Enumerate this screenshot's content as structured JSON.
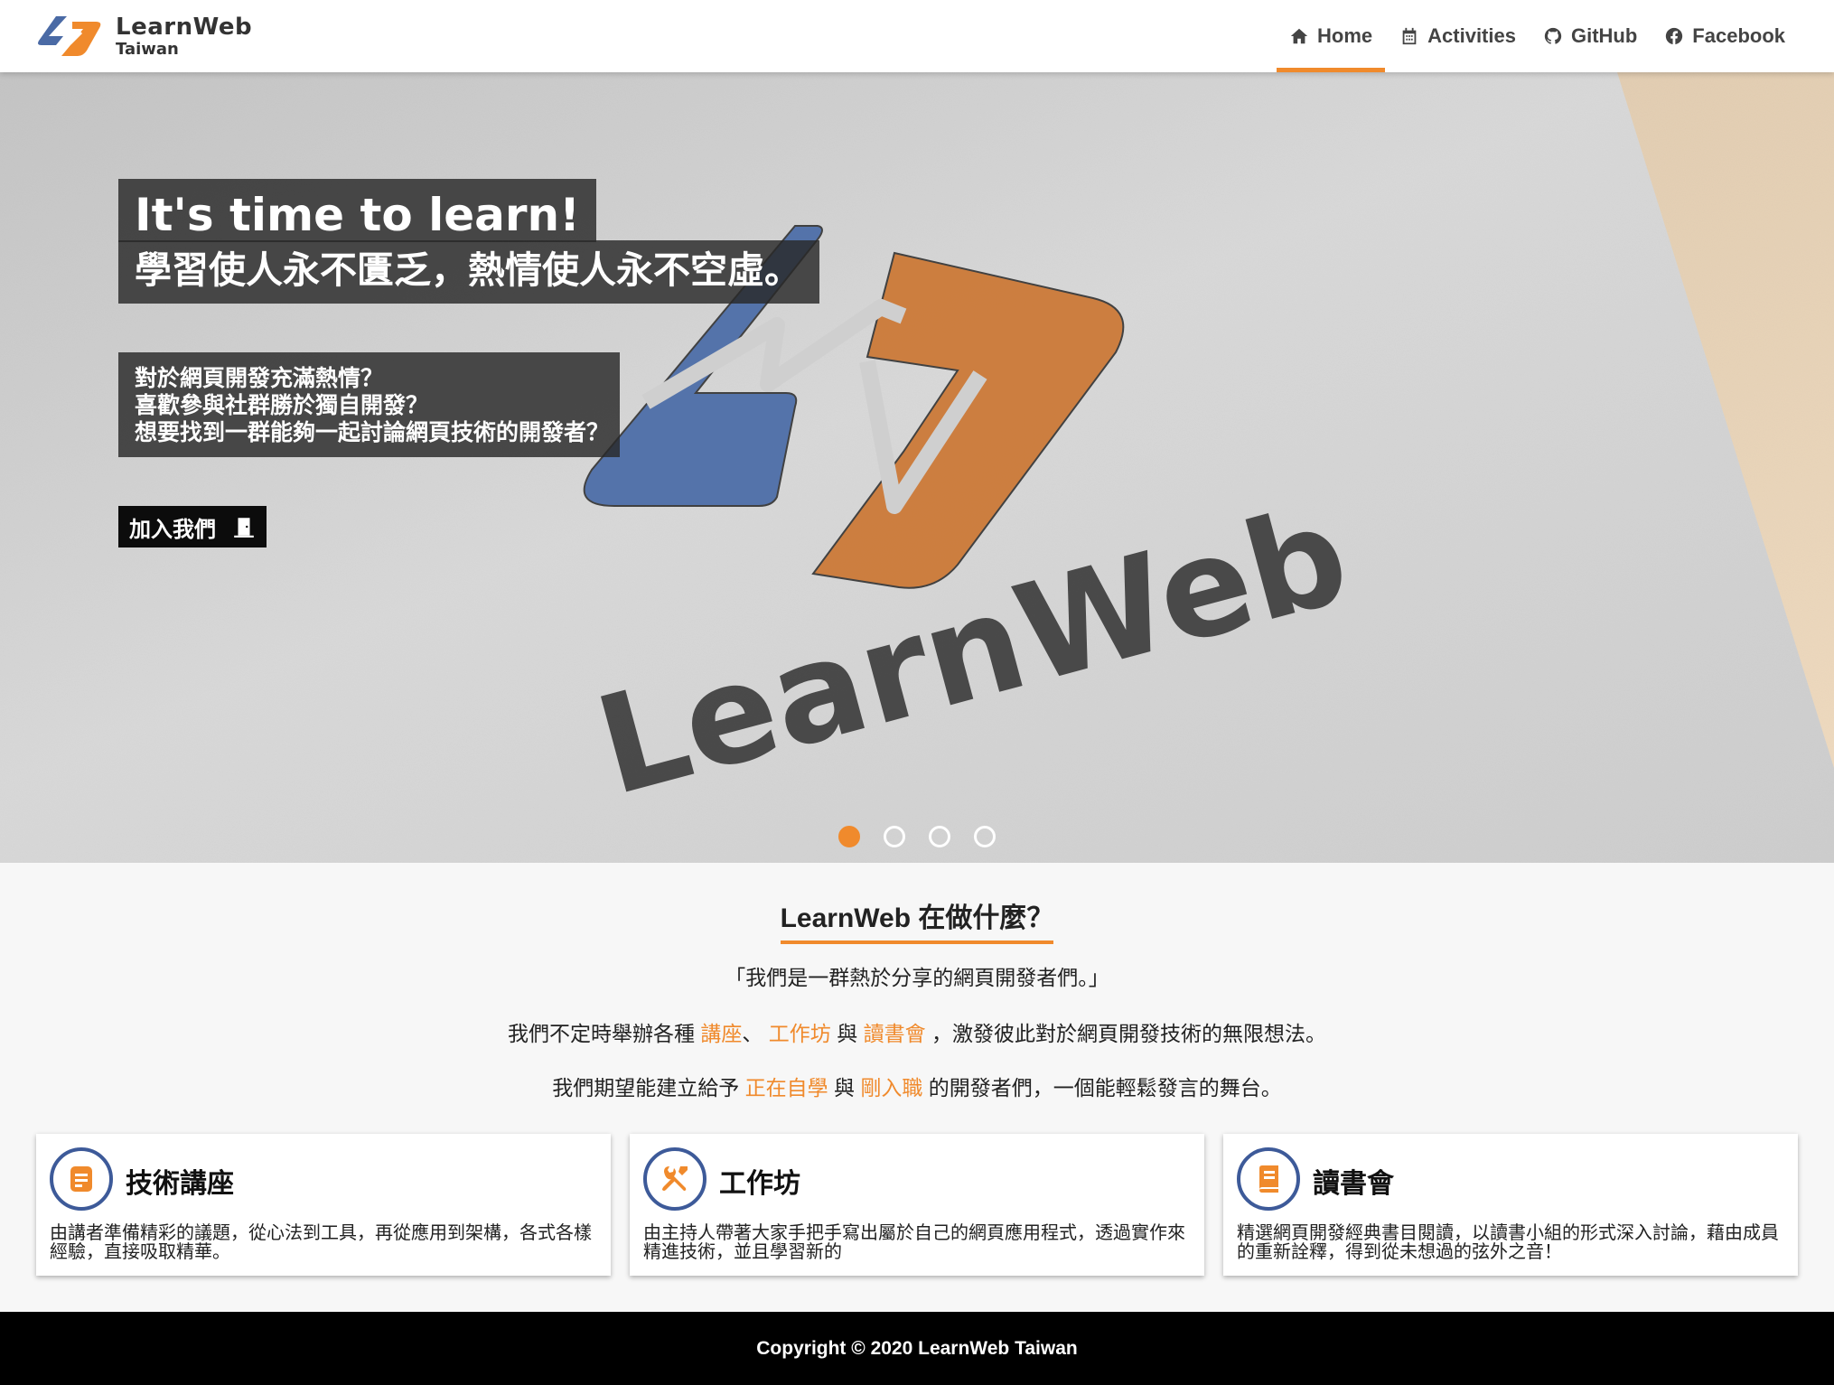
{
  "brand": {
    "name": "LearnWeb",
    "subtitle": "Taiwan"
  },
  "nav": {
    "items": [
      {
        "label": "Home",
        "icon": "home-icon",
        "active": true
      },
      {
        "label": "Activities",
        "icon": "calendar-icon",
        "active": false
      },
      {
        "label": "GitHub",
        "icon": "github-icon",
        "active": false
      },
      {
        "label": "Facebook",
        "icon": "facebook-icon",
        "active": false
      }
    ]
  },
  "hero": {
    "title": "It's time to learn!",
    "subtitle": "學習使人永不匱乏，熱情使人永不空虛。",
    "lines": [
      "對於網頁開發充滿熱情？",
      "喜歡參與社群勝於獨自開發？",
      "想要找到一群能夠一起討論網頁技術的開發者？"
    ],
    "join_label": "加入我們",
    "background_logo_text": "LearnWeb",
    "carousel": {
      "count": 4,
      "active_index": 0
    }
  },
  "about": {
    "title": "LearnWeb 在做什麼？",
    "quote": "「我們是一群熱於分享的網頁開發者們。」",
    "p2": {
      "before": "我們不定時舉辦各種",
      "kw1": "講座",
      "sep1": "、",
      "kw2": "工作坊",
      "sep2": "與",
      "kw3": "讀書會",
      "after": "，激發彼此對於網頁開發技術的無限想法。"
    },
    "p3": {
      "before": "我們期望能建立給予",
      "kw1": "正在自學",
      "sep1": "與",
      "kw2": "剛入職",
      "after": "的開發者們，一個能輕鬆發言的舞台。"
    }
  },
  "cards": [
    {
      "icon": "document-icon",
      "title": "技術講座",
      "text": "由講者準備精彩的議題，從心法到工具，再從應用到架構，各式各樣經驗，直接吸取精華。"
    },
    {
      "icon": "tools-icon",
      "title": "工作坊",
      "text": "由主持人帶著大家手把手寫出屬於自己的網頁應用程式，透過實作來精進技術，並且學習新的"
    },
    {
      "icon": "book-icon",
      "title": "讀書會",
      "text": "精選網頁開發經典書目閱讀，以讀書小組的形式深入討論，藉由成員的重新詮釋，得到從未想過的弦外之音！"
    }
  ],
  "footer": {
    "copyright": "Copyright © 2020 LearnWeb Taiwan"
  },
  "colors": {
    "accent": "#f08a2c",
    "brand_blue": "#3d5a99",
    "footer_bg": "#000000",
    "page_bg": "#f7f7f7"
  }
}
